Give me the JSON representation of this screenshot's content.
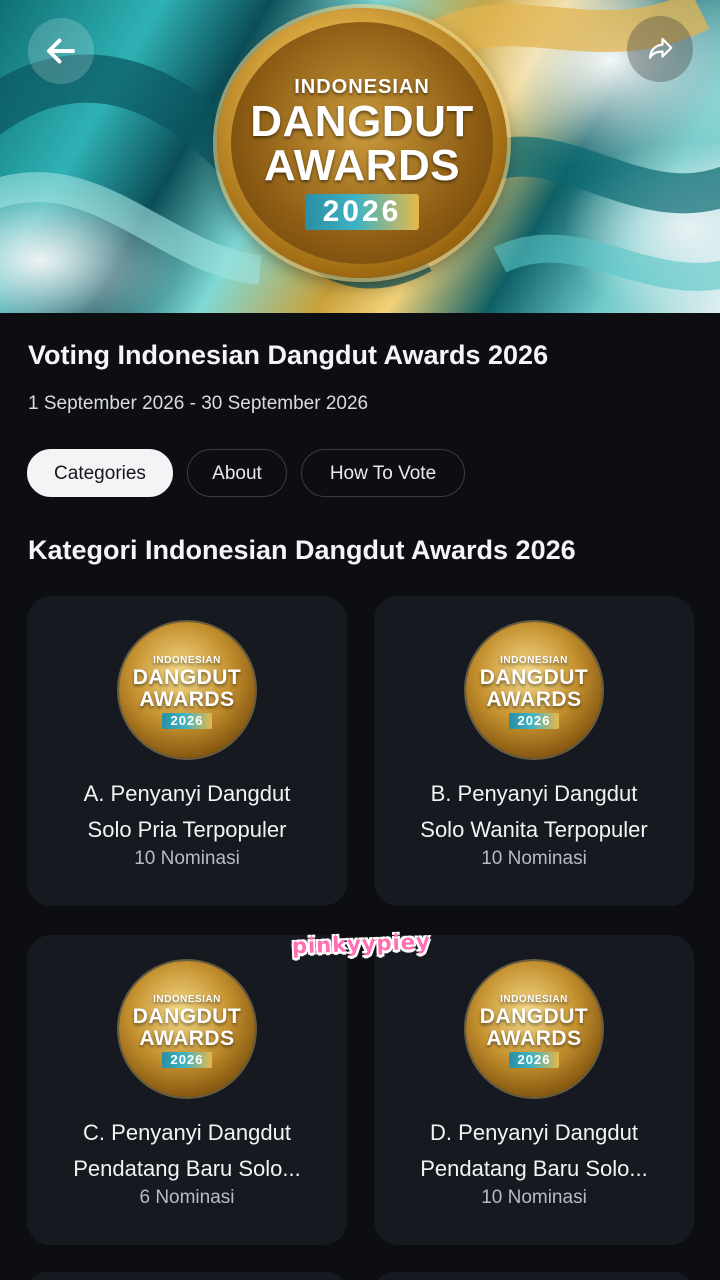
{
  "hero": {
    "logo_line1": "INDONESIAN",
    "logo_line2": "DANGDUT",
    "logo_line3": "AWARDS",
    "logo_year": "2026"
  },
  "nav": {
    "back_icon": "arrow-left-icon",
    "share_icon": "share-icon"
  },
  "event": {
    "title": "Voting Indonesian Dangdut Awards 2026",
    "date_range": "1 September 2026 - 30 September 2026"
  },
  "tabs": [
    {
      "label": "Categories",
      "active": true
    },
    {
      "label": "About",
      "active": false
    },
    {
      "label": "How To Vote",
      "active": false
    }
  ],
  "section": {
    "title": "Kategori Indonesian Dangdut Awards 2026"
  },
  "badge": {
    "line1": "INDONESIAN",
    "line2": "DANGDUT",
    "line3": "AWARDS",
    "year": "2026"
  },
  "categories": [
    {
      "line1": "A. Penyanyi Dangdut",
      "line2": "Solo Pria Terpopuler",
      "count": "10 Nominasi"
    },
    {
      "line1": "B. Penyanyi Dangdut",
      "line2": "Solo Wanita Terpopuler",
      "count": "10 Nominasi"
    },
    {
      "line1": "C. Penyanyi Dangdut",
      "line2": "Pendatang Baru Solo...",
      "count": "6 Nominasi"
    },
    {
      "line1": "D. Penyanyi Dangdut",
      "line2": "Pendatang Baru Solo...",
      "count": "10 Nominasi"
    }
  ],
  "watermark": "pinkyypiey",
  "colors": {
    "background": "#0c0e12",
    "card": "#16191f",
    "active_tab": "#f4f4f6",
    "gold": "#d8a640",
    "teal": "#2fb2b5"
  }
}
